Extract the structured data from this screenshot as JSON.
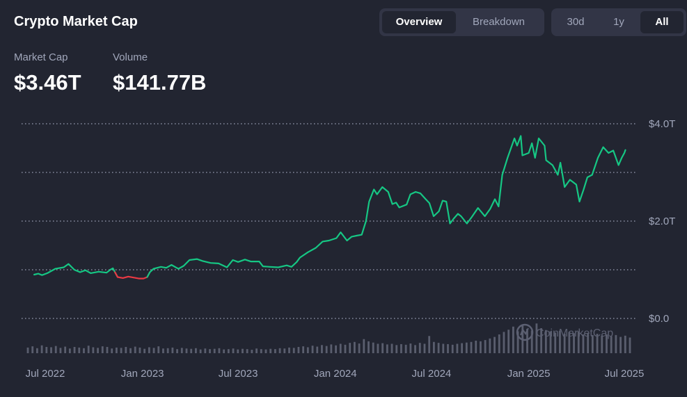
{
  "header": {
    "title": "Crypto Market Cap",
    "view_tabs": [
      {
        "label": "Overview",
        "active": true
      },
      {
        "label": "Breakdown",
        "active": false
      }
    ],
    "range_tabs": [
      {
        "label": "30d",
        "active": false
      },
      {
        "label": "1y",
        "active": false
      },
      {
        "label": "All",
        "active": true
      }
    ]
  },
  "stats": {
    "market_cap": {
      "label": "Market Cap",
      "value": "$3.46T"
    },
    "volume": {
      "label": "Volume",
      "value": "$141.77B"
    }
  },
  "watermark": {
    "text": "CoinMarketCap",
    "icon": "coinmarketcap-logo-icon"
  },
  "colors": {
    "background": "#222531",
    "up": "#16c784",
    "down": "#ea3943",
    "grid": "#8a8fa3",
    "volume": "#5a5e6e",
    "text_muted": "#a1a7bb"
  },
  "chart_data": {
    "type": "line",
    "title": "",
    "xlabel": "",
    "ylabel": "",
    "y_unit": "trillion USD",
    "ylim": [
      0,
      4
    ],
    "y_ticks": [
      {
        "value": 0,
        "label": "$0.0"
      },
      {
        "value": 1,
        "label": ""
      },
      {
        "value": 2,
        "label": "$2.0T"
      },
      {
        "value": 3,
        "label": ""
      },
      {
        "value": 4,
        "label": "$4.0T"
      }
    ],
    "x_ticks": [
      {
        "date": "2022-07-01",
        "label": "Jul 2022"
      },
      {
        "date": "2023-01-01",
        "label": "Jan 2023"
      },
      {
        "date": "2023-07-01",
        "label": "Jul 2023"
      },
      {
        "date": "2024-01-01",
        "label": "Jan 2024"
      },
      {
        "date": "2024-07-01",
        "label": "Jul 2024"
      },
      {
        "date": "2025-01-01",
        "label": "Jan 2025"
      },
      {
        "date": "2025-07-01",
        "label": "Jul 2025"
      }
    ],
    "grid": true,
    "series": [
      {
        "points": [
          [
            "2022-06-10",
            0.9
          ],
          [
            "2022-06-18",
            0.92
          ],
          [
            "2022-06-25",
            0.89
          ],
          [
            "2022-07-05",
            0.93
          ],
          [
            "2022-07-20",
            1.02
          ],
          [
            "2022-08-05",
            1.05
          ],
          [
            "2022-08-14",
            1.12
          ],
          [
            "2022-08-25",
            1.0
          ],
          [
            "2022-09-05",
            0.95
          ],
          [
            "2022-09-15",
            0.99
          ],
          [
            "2022-09-25",
            0.93
          ],
          [
            "2022-10-10",
            0.96
          ],
          [
            "2022-10-25",
            0.94
          ],
          [
            "2022-11-01",
            1.0
          ],
          [
            "2022-11-06",
            1.03
          ],
          [
            "2022-11-10",
            0.95
          ],
          [
            "2022-11-15",
            0.85
          ],
          [
            "2022-11-25",
            0.83
          ],
          [
            "2022-12-05",
            0.86
          ],
          [
            "2022-12-15",
            0.84
          ],
          [
            "2022-12-25",
            0.82
          ],
          [
            "2023-01-03",
            0.82
          ],
          [
            "2023-01-10",
            0.85
          ],
          [
            "2023-01-15",
            0.95
          ],
          [
            "2023-01-22",
            1.02
          ],
          [
            "2023-02-05",
            1.06
          ],
          [
            "2023-02-15",
            1.04
          ],
          [
            "2023-02-25",
            1.1
          ],
          [
            "2023-03-10",
            1.02
          ],
          [
            "2023-03-20",
            1.08
          ],
          [
            "2023-03-31",
            1.2
          ],
          [
            "2023-04-14",
            1.22
          ],
          [
            "2023-04-25",
            1.18
          ],
          [
            "2023-05-10",
            1.14
          ],
          [
            "2023-05-25",
            1.13
          ],
          [
            "2023-06-10",
            1.05
          ],
          [
            "2023-06-21",
            1.2
          ],
          [
            "2023-07-01",
            1.16
          ],
          [
            "2023-07-14",
            1.21
          ],
          [
            "2023-07-25",
            1.17
          ],
          [
            "2023-08-10",
            1.17
          ],
          [
            "2023-08-17",
            1.07
          ],
          [
            "2023-08-30",
            1.06
          ],
          [
            "2023-09-15",
            1.05
          ],
          [
            "2023-10-01",
            1.09
          ],
          [
            "2023-10-10",
            1.06
          ],
          [
            "2023-10-20",
            1.16
          ],
          [
            "2023-10-26",
            1.25
          ],
          [
            "2023-11-10",
            1.36
          ],
          [
            "2023-11-25",
            1.45
          ],
          [
            "2023-12-08",
            1.58
          ],
          [
            "2023-12-20",
            1.6
          ],
          [
            "2024-01-03",
            1.65
          ],
          [
            "2024-01-11",
            1.77
          ],
          [
            "2024-01-23",
            1.6
          ],
          [
            "2024-02-01",
            1.68
          ],
          [
            "2024-02-10",
            1.7
          ],
          [
            "2024-02-20",
            1.72
          ],
          [
            "2024-02-28",
            2.0
          ],
          [
            "2024-03-05",
            2.4
          ],
          [
            "2024-03-14",
            2.65
          ],
          [
            "2024-03-20",
            2.55
          ],
          [
            "2024-03-30",
            2.7
          ],
          [
            "2024-04-10",
            2.6
          ],
          [
            "2024-04-18",
            2.35
          ],
          [
            "2024-04-25",
            2.38
          ],
          [
            "2024-05-01",
            2.28
          ],
          [
            "2024-05-15",
            2.34
          ],
          [
            "2024-05-22",
            2.55
          ],
          [
            "2024-06-01",
            2.6
          ],
          [
            "2024-06-10",
            2.57
          ],
          [
            "2024-06-20",
            2.45
          ],
          [
            "2024-06-27",
            2.37
          ],
          [
            "2024-07-05",
            2.1
          ],
          [
            "2024-07-15",
            2.2
          ],
          [
            "2024-07-22",
            2.42
          ],
          [
            "2024-07-29",
            2.4
          ],
          [
            "2024-08-05",
            1.95
          ],
          [
            "2024-08-12",
            2.05
          ],
          [
            "2024-08-20",
            2.15
          ],
          [
            "2024-08-26",
            2.1
          ],
          [
            "2024-09-06",
            1.95
          ],
          [
            "2024-09-15",
            2.08
          ],
          [
            "2024-09-27",
            2.27
          ],
          [
            "2024-10-10",
            2.1
          ],
          [
            "2024-10-20",
            2.25
          ],
          [
            "2024-10-29",
            2.45
          ],
          [
            "2024-11-05",
            2.3
          ],
          [
            "2024-11-12",
            2.95
          ],
          [
            "2024-11-22",
            3.3
          ],
          [
            "2024-12-05",
            3.7
          ],
          [
            "2024-12-10",
            3.55
          ],
          [
            "2024-12-17",
            3.75
          ],
          [
            "2024-12-20",
            3.35
          ],
          [
            "2025-01-01",
            3.4
          ],
          [
            "2025-01-07",
            3.6
          ],
          [
            "2025-01-13",
            3.3
          ],
          [
            "2025-01-20",
            3.7
          ],
          [
            "2025-01-31",
            3.55
          ],
          [
            "2025-02-03",
            3.25
          ],
          [
            "2025-02-15",
            3.15
          ],
          [
            "2025-02-25",
            2.95
          ],
          [
            "2025-03-02",
            3.2
          ],
          [
            "2025-03-10",
            2.7
          ],
          [
            "2025-03-20",
            2.85
          ],
          [
            "2025-04-01",
            2.75
          ],
          [
            "2025-04-07",
            2.4
          ],
          [
            "2025-04-15",
            2.65
          ],
          [
            "2025-04-22",
            2.9
          ],
          [
            "2025-05-01",
            2.95
          ],
          [
            "2025-05-12",
            3.3
          ],
          [
            "2025-05-22",
            3.52
          ],
          [
            "2025-06-01",
            3.4
          ],
          [
            "2025-06-10",
            3.45
          ],
          [
            "2025-06-20",
            3.15
          ],
          [
            "2025-06-26",
            3.3
          ],
          [
            "2025-07-01",
            3.4
          ],
          [
            "2025-07-03",
            3.46
          ]
        ]
      }
    ],
    "volume_relative": [
      0.18,
      0.22,
      0.16,
      0.25,
      0.2,
      0.19,
      0.23,
      0.17,
      0.21,
      0.15,
      0.2,
      0.18,
      0.16,
      0.24,
      0.19,
      0.17,
      0.22,
      0.2,
      0.15,
      0.18,
      0.17,
      0.2,
      0.16,
      0.21,
      0.18,
      0.14,
      0.19,
      0.17,
      0.22,
      0.15,
      0.16,
      0.18,
      0.13,
      0.17,
      0.15,
      0.14,
      0.16,
      0.12,
      0.15,
      0.13,
      0.14,
      0.16,
      0.12,
      0.13,
      0.15,
      0.12,
      0.14,
      0.13,
      0.11,
      0.15,
      0.13,
      0.12,
      0.14,
      0.13,
      0.16,
      0.15,
      0.18,
      0.17,
      0.2,
      0.22,
      0.19,
      0.24,
      0.21,
      0.26,
      0.23,
      0.28,
      0.25,
      0.3,
      0.27,
      0.33,
      0.36,
      0.31,
      0.45,
      0.38,
      0.34,
      0.3,
      0.32,
      0.28,
      0.3,
      0.26,
      0.29,
      0.27,
      0.31,
      0.26,
      0.33,
      0.3,
      0.55,
      0.36,
      0.33,
      0.3,
      0.29,
      0.27,
      0.3,
      0.32,
      0.34,
      0.36,
      0.4,
      0.38,
      0.42,
      0.47,
      0.52,
      0.6,
      0.68,
      0.75,
      0.85,
      0.7,
      0.9,
      0.78,
      0.72,
      0.95,
      0.8,
      0.74,
      0.7,
      0.66,
      0.72,
      0.62,
      0.68,
      0.64,
      0.7,
      0.6,
      0.65,
      0.58,
      0.62,
      0.56,
      0.6,
      0.54,
      0.58,
      0.52,
      0.56,
      0.5
    ]
  }
}
